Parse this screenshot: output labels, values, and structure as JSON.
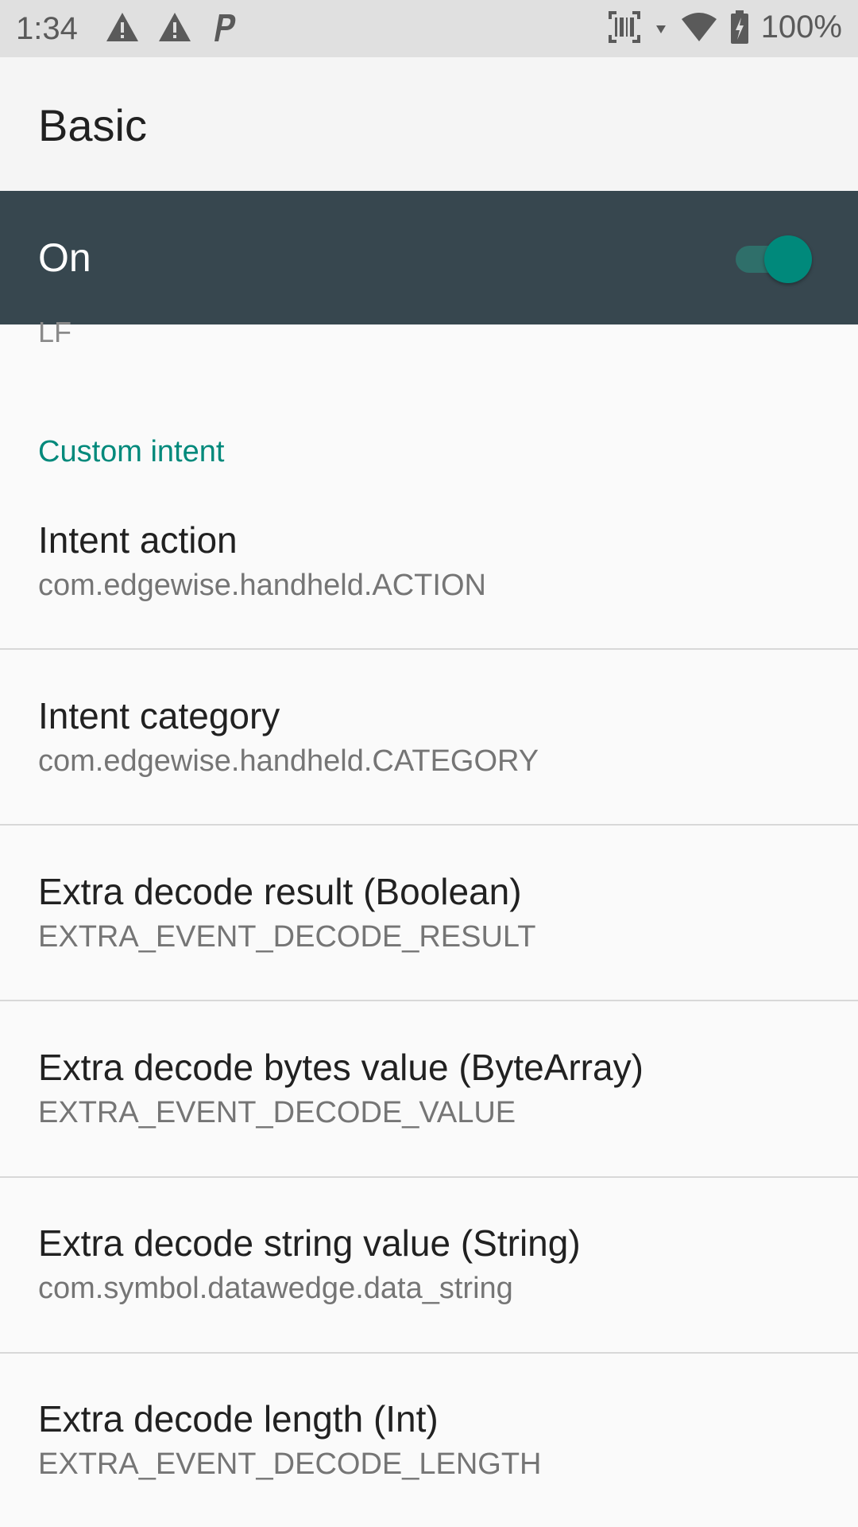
{
  "status_bar": {
    "time": "1:34",
    "battery_percent": "100%",
    "icons": [
      "warning-icon",
      "warning-icon",
      "parking-icon",
      "barcode-scanner-icon",
      "data-arrow-icon",
      "wifi-icon",
      "battery-charging-icon"
    ]
  },
  "app_bar": {
    "title": "Basic"
  },
  "master_switch": {
    "label": "On",
    "state": true
  },
  "previous_item_summary_clipped": "LF",
  "section": {
    "title": "Custom intent"
  },
  "items": [
    {
      "title": "Intent action",
      "summary": "com.edgewise.handheld.ACTION"
    },
    {
      "title": "Intent category",
      "summary": "com.edgewise.handheld.CATEGORY"
    },
    {
      "title": "Extra decode result (Boolean)",
      "summary": "EXTRA_EVENT_DECODE_RESULT"
    },
    {
      "title": "Extra decode bytes value (ByteArray)",
      "summary": "EXTRA_EVENT_DECODE_VALUE"
    },
    {
      "title": "Extra decode string value (String)",
      "summary": "com.symbol.datawedge.data_string"
    },
    {
      "title": "Extra decode length (Int)",
      "summary": "EXTRA_EVENT_DECODE_LENGTH"
    }
  ],
  "colors": {
    "accent": "#00897b",
    "switch_bar": "#37474f",
    "status_bar": "#e0e0e0",
    "app_bar": "#f5f5f5"
  }
}
